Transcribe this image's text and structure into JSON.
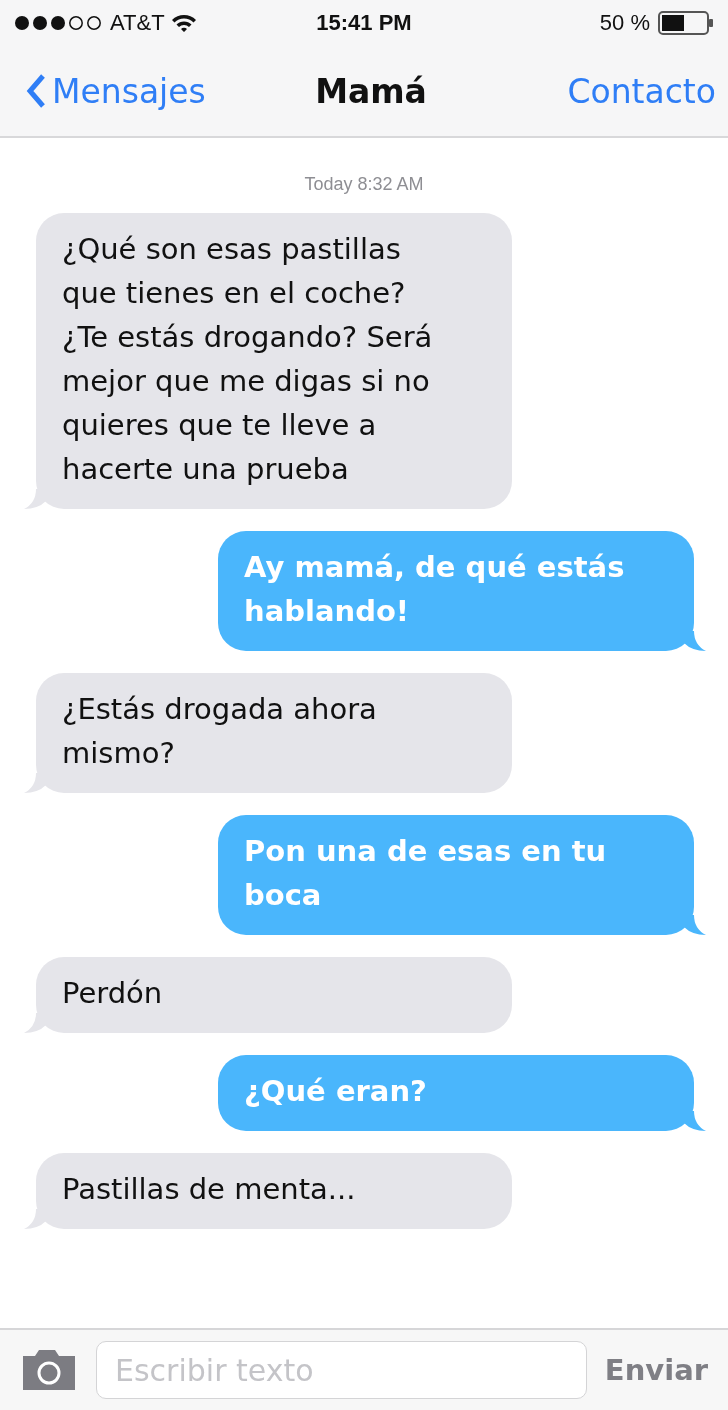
{
  "status_bar": {
    "carrier": "AT&T",
    "time": "15:41 PM",
    "battery": "50 %"
  },
  "nav": {
    "back": "Mensajes",
    "title": "Mamá",
    "action": "Contacto"
  },
  "timestamp": "Today 8:32 AM",
  "messages": [
    {
      "kind": "incoming",
      "text": "¿Qué son esas pastillas que tienes en el coche? ¿Te estás drogando? Será mejor que me digas si no quieres que te lleve a hacerte una prueba"
    },
    {
      "kind": "outgoing",
      "text": "Ay mamá, de qué estás hablando!"
    },
    {
      "kind": "incoming",
      "text": "¿Estás drogada ahora mismo?"
    },
    {
      "kind": "outgoing",
      "text": "Pon una de esas en tu boca"
    },
    {
      "kind": "incoming",
      "text": "Perdón"
    },
    {
      "kind": "outgoing",
      "text": "¿Qué eran?"
    },
    {
      "kind": "incoming",
      "text": "Pastillas de menta..."
    }
  ],
  "composer": {
    "placeholder": "Escribir texto",
    "send": "Enviar"
  }
}
